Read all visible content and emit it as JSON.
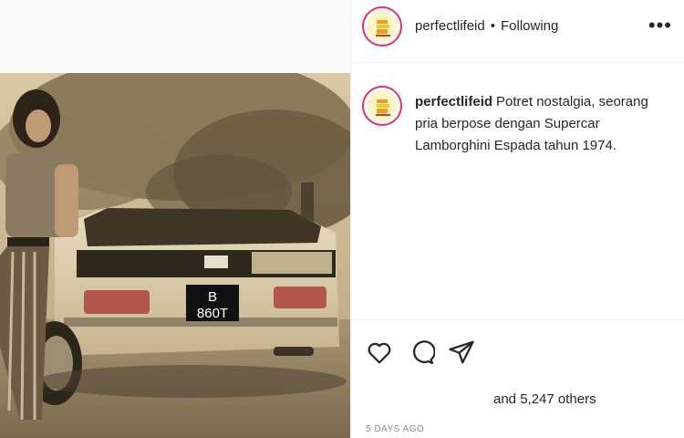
{
  "post": {
    "username": "perfectlifeid",
    "separator": "•",
    "follow_status": "Following",
    "more_label": "•••",
    "caption": "Potret nostalgia, seorang pria berpose dengan Supercar Lamborghini Espada tahun 1974.",
    "likes_text": "and 5,247 others",
    "timestamp": "5 DAYS AGO"
  },
  "photo": {
    "plate_line1": "B",
    "plate_line2": "860T"
  },
  "icons": {
    "like": "heart-icon",
    "comment": "comment-icon",
    "share": "paper-plane-icon",
    "more": "more-options-icon"
  },
  "colors": {
    "avatar_ring": "#e1306c",
    "text": "#262626",
    "muted": "#8e8e8e",
    "photo_tone": "#c9b690"
  }
}
